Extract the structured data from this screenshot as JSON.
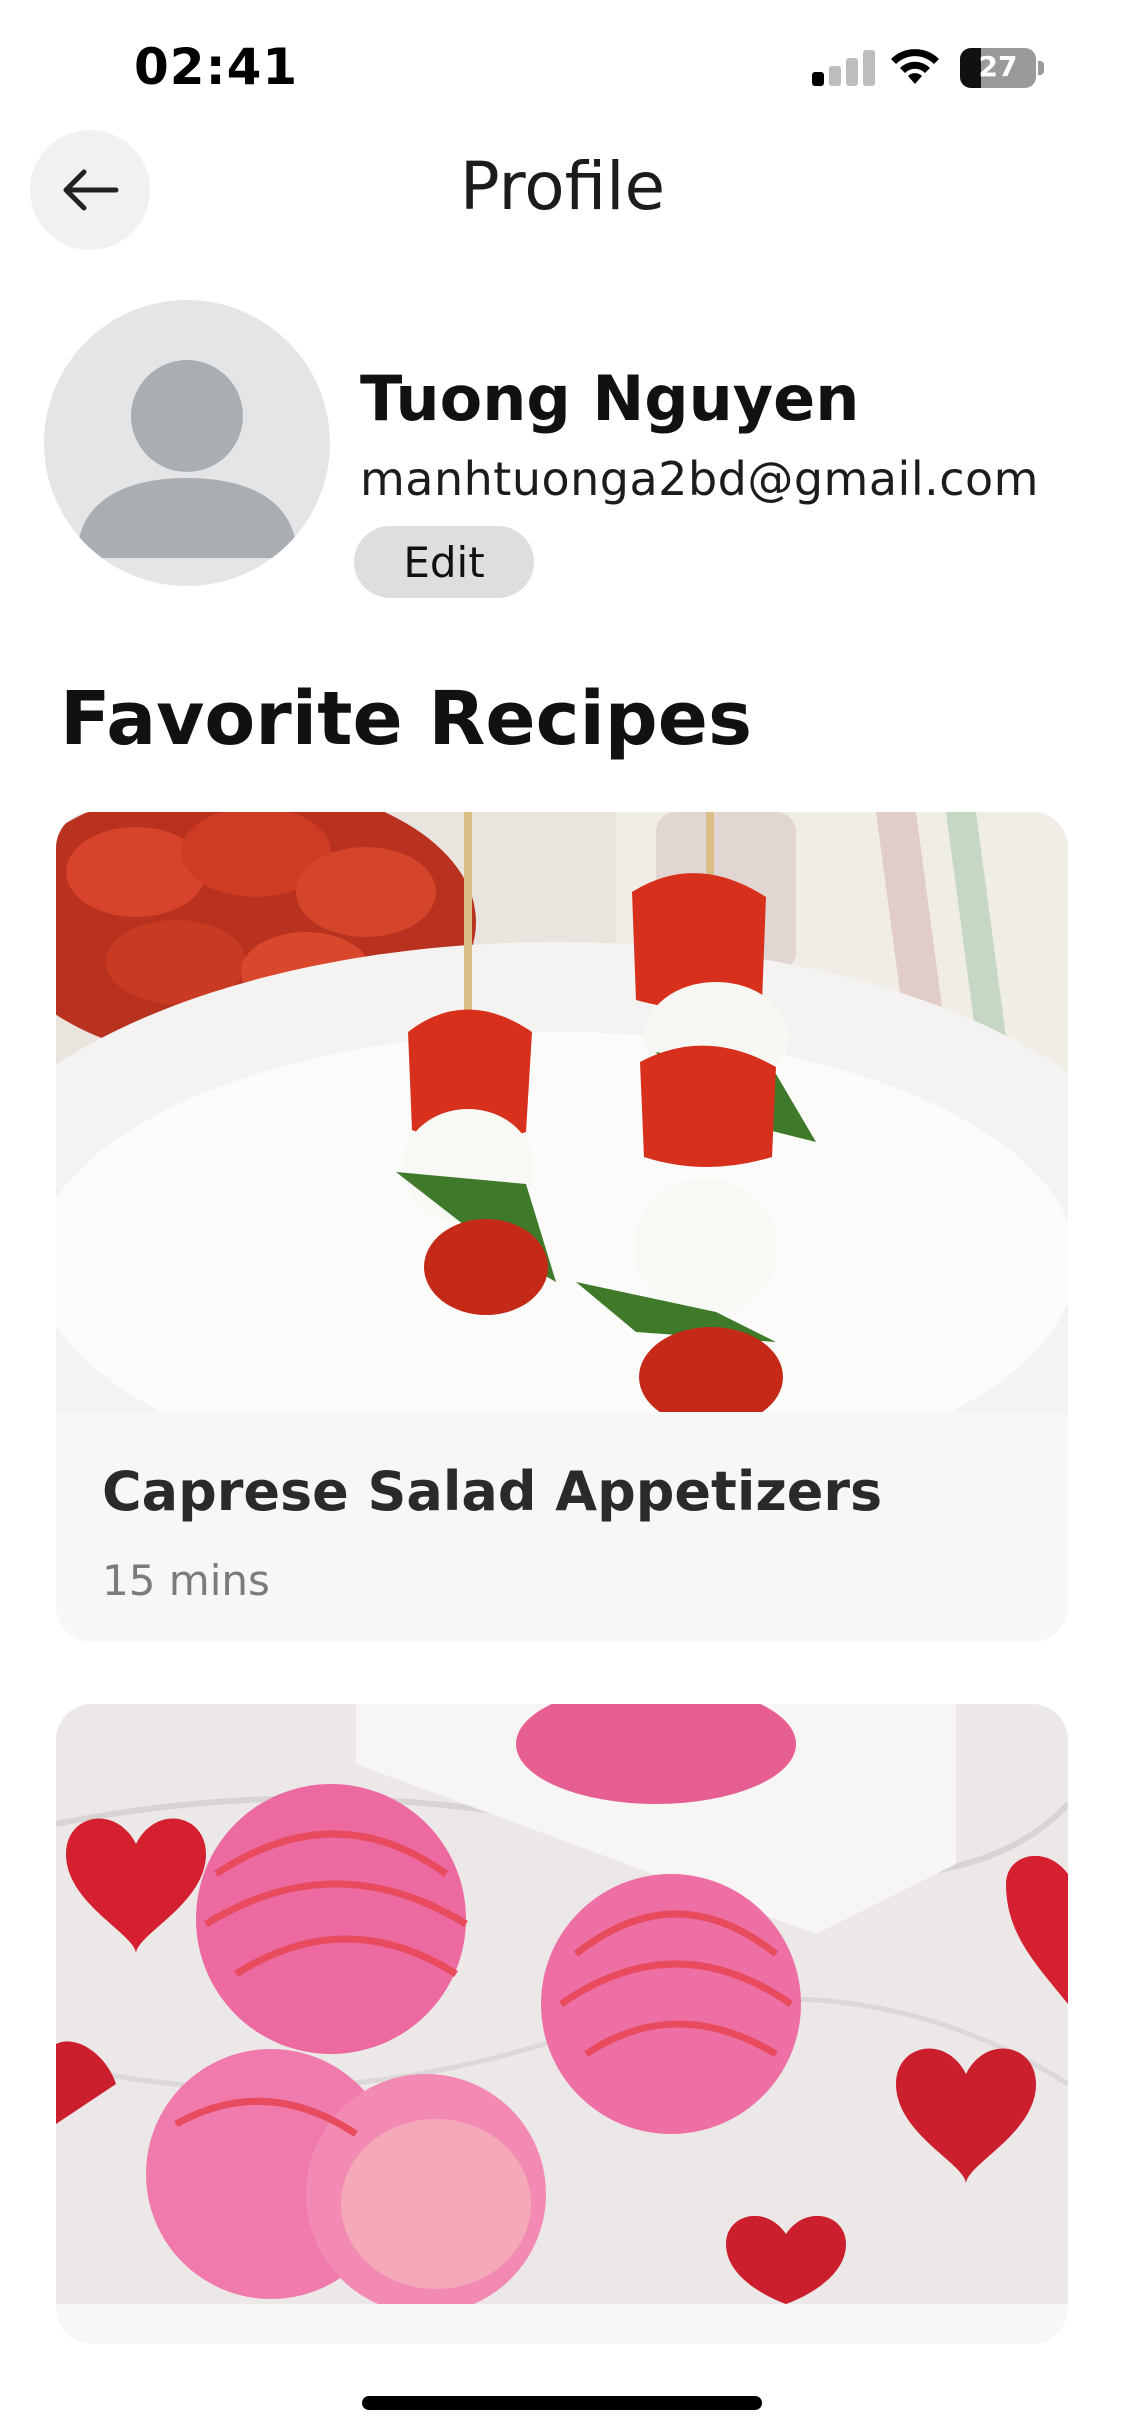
{
  "status_bar": {
    "time": "02:41",
    "battery_level": "27",
    "battery_percent": 27,
    "icons": [
      "cellular-signal-icon",
      "wifi-icon",
      "battery-icon"
    ]
  },
  "header": {
    "title": "Profile",
    "back_icon": "arrow-left-icon"
  },
  "profile": {
    "name": "Tuong Nguyen",
    "email": "manhtuonga2bd@gmail.com",
    "edit_label": "Edit",
    "avatar_icon": "user-placeholder-icon"
  },
  "favorites": {
    "title": "Favorite Recipes",
    "recipes": [
      {
        "title": "Caprese Salad Appetizers",
        "time": "15 mins",
        "image": "caprese-skewers-photo"
      },
      {
        "title": "",
        "time": "",
        "image": "pink-cake-balls-photo"
      }
    ]
  },
  "colors": {
    "background": "#ffffff",
    "card_background": "#f7f7f7",
    "back_button_bg": "#f1f1f1",
    "edit_button_bg": "#dedede",
    "avatar_bg": "#e3e5e7",
    "avatar_figure": "#a9aeb3",
    "secondary_text": "#7b7b7b"
  }
}
